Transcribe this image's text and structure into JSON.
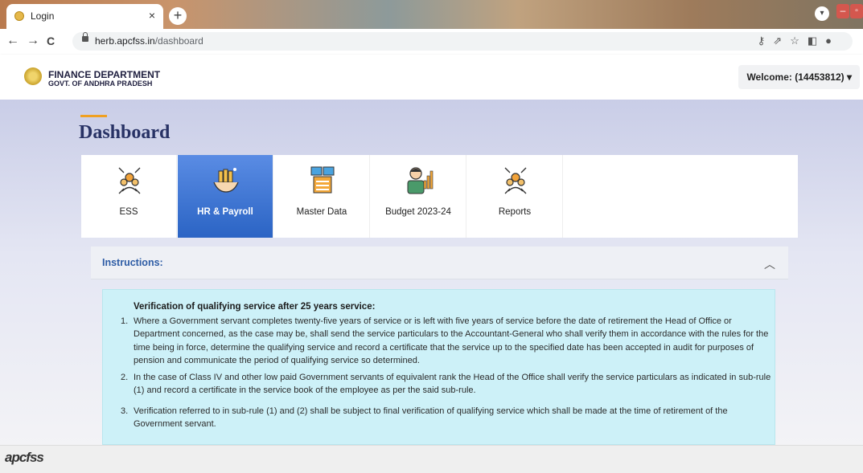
{
  "browser": {
    "tab_title": "Login",
    "tab_close": "×",
    "new_tab": "+",
    "url_host": "herb.apcfss.in",
    "url_path": "/dashboard"
  },
  "header": {
    "dept_line1": "FINANCE DEPARTMENT",
    "dept_line2": "GOVT. OF ANDHRA PRADESH",
    "welcome": "Welcome: (14453812)"
  },
  "page": {
    "title": "Dashboard"
  },
  "modules": [
    {
      "label": "ESS",
      "icon": "network-people-icon"
    },
    {
      "label": "HR & Payroll",
      "icon": "hands-money-icon",
      "active": true
    },
    {
      "label": "Master Data",
      "icon": "data-server-icon"
    },
    {
      "label": "Budget 2023-24",
      "icon": "budget-person-chart-icon"
    },
    {
      "label": "Reports",
      "icon": "network-people-icon"
    }
  ],
  "instructions": {
    "title": "Instructions:",
    "heading": "Verification of qualifying service after 25 years service:",
    "items": [
      {
        "num": "1.",
        "text": "Where a Government servant completes twenty-five years of service or is left with five years of service before the date of retirement the Head of Office or Department concerned, as the case may be, shall send the service particulars to the Accountant-General who shall verify them in accordance with the rules for the time being in force, determine the qualifying service and record a certificate that the service up to the specified date has been accepted in audit for purposes of pension and communicate the period of qualifying service so determined."
      },
      {
        "num": "2.",
        "text": "In the case of Class IV and other low paid Government servants of equivalent rank the Head of the Office shall verify the service particulars as indicated in sub-rule (1) and record a certificate in the service book of the employee as per the said sub-rule."
      },
      {
        "num": "3.",
        "text": "Verification referred to in sub-rule (1) and (2) shall be subject to final verification of qualifying service which shall be made at the time of retirement of the Government servant."
      }
    ]
  },
  "footer": {
    "logo": "apcfss"
  }
}
